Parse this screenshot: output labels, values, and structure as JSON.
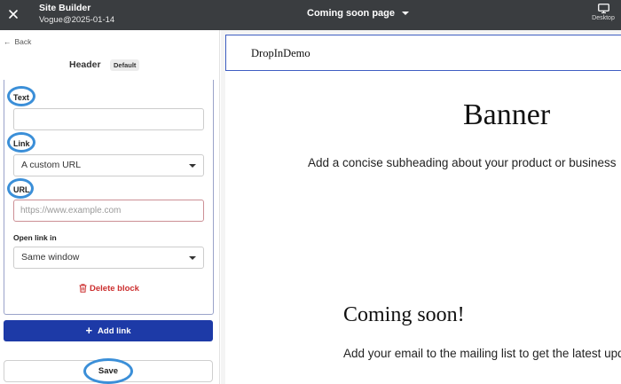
{
  "topbar": {
    "close_icon": "close-icon",
    "app_title": "Site Builder",
    "site_name": "Vogue@2025-01-14",
    "page_selector": "Coming soon page",
    "device_label": "Desktop"
  },
  "left_panel": {
    "back_label": "Back",
    "section_title": "Header",
    "section_badge": "Default",
    "fields": {
      "text": {
        "label": "Text",
        "value": ""
      },
      "link": {
        "label": "Link",
        "value": "A custom URL"
      },
      "url": {
        "label": "URL",
        "placeholder": "https://www.example.com",
        "value": ""
      },
      "open_in": {
        "label": "Open link in",
        "value": "Same window"
      }
    },
    "delete_label": "Delete block",
    "add_link_label": "Add link",
    "save_label": "Save"
  },
  "preview": {
    "logo": "DropInDemo",
    "banner_title": "Banner",
    "banner_subheading": "Add a concise subheading about your product or business",
    "soon_title": "Coming soon!",
    "soon_subheading": "Add your email to the mailing list to get the latest updates"
  },
  "colors": {
    "topbar": "#3a3d40",
    "primary_button": "#1d3aa7",
    "delete": "#cc2f2f",
    "annotation": "#3b8fd8"
  }
}
